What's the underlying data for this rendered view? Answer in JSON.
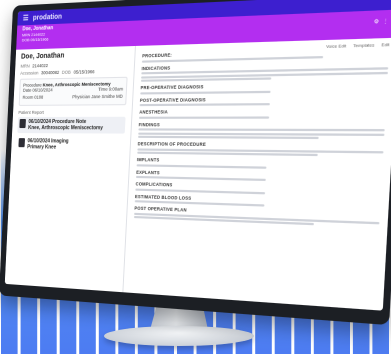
{
  "app": {
    "name": "prodation"
  },
  "patient_bar": {
    "name": "Doe, Jonathan",
    "line1": "MRN 2144022",
    "line2": "DOB 05/15/1966"
  },
  "patient": {
    "name": "Doe, Jonathan",
    "mrn_label": "MRN",
    "mrn": "2144022",
    "accession_label": "Accession",
    "accession": "30040082",
    "dob_label": "DOB",
    "dob": "05/15/1966"
  },
  "procedure": {
    "label": "Procedure",
    "value": "Knee, Arthroscopic Meniscectomy",
    "date_label": "Date",
    "date": "06/10/2024",
    "time_label": "Time",
    "time": "9:00am",
    "room_label": "Room",
    "room": "0108",
    "physician_label": "Physician",
    "physician": "Jane Smithe MD"
  },
  "reports": {
    "heading": "Patient Report",
    "items": [
      {
        "line1": "06/10/2024 Procedure Note",
        "line2": "Knee, Arthroscopic Meniscectomy"
      },
      {
        "line1": "06/10/2024 Imaging",
        "line2": "Primary Knee"
      }
    ]
  },
  "note": {
    "tools": [
      "Voice Edit",
      "Templates",
      "Edit"
    ],
    "sections": [
      "PROCEDURE:",
      "INDICATIONS",
      "PRE-OPERATIVE DIAGNOSIS",
      "POST-OPERATIVE DIAGNOSIS",
      "ANESTHESIA",
      "FINDINGS",
      "DESCRIPTION OF PROCEDURE",
      "IMPLANTS",
      "EXPLANTS",
      "COMPLICATIONS",
      "ESTIMATED BLOOD LOSS",
      "POST OPERATIVE PLAN"
    ]
  },
  "colors": {
    "topbar": "#3d1fcf",
    "patient_bar": "#b32ef0",
    "background_bars": "#3f86f0"
  }
}
